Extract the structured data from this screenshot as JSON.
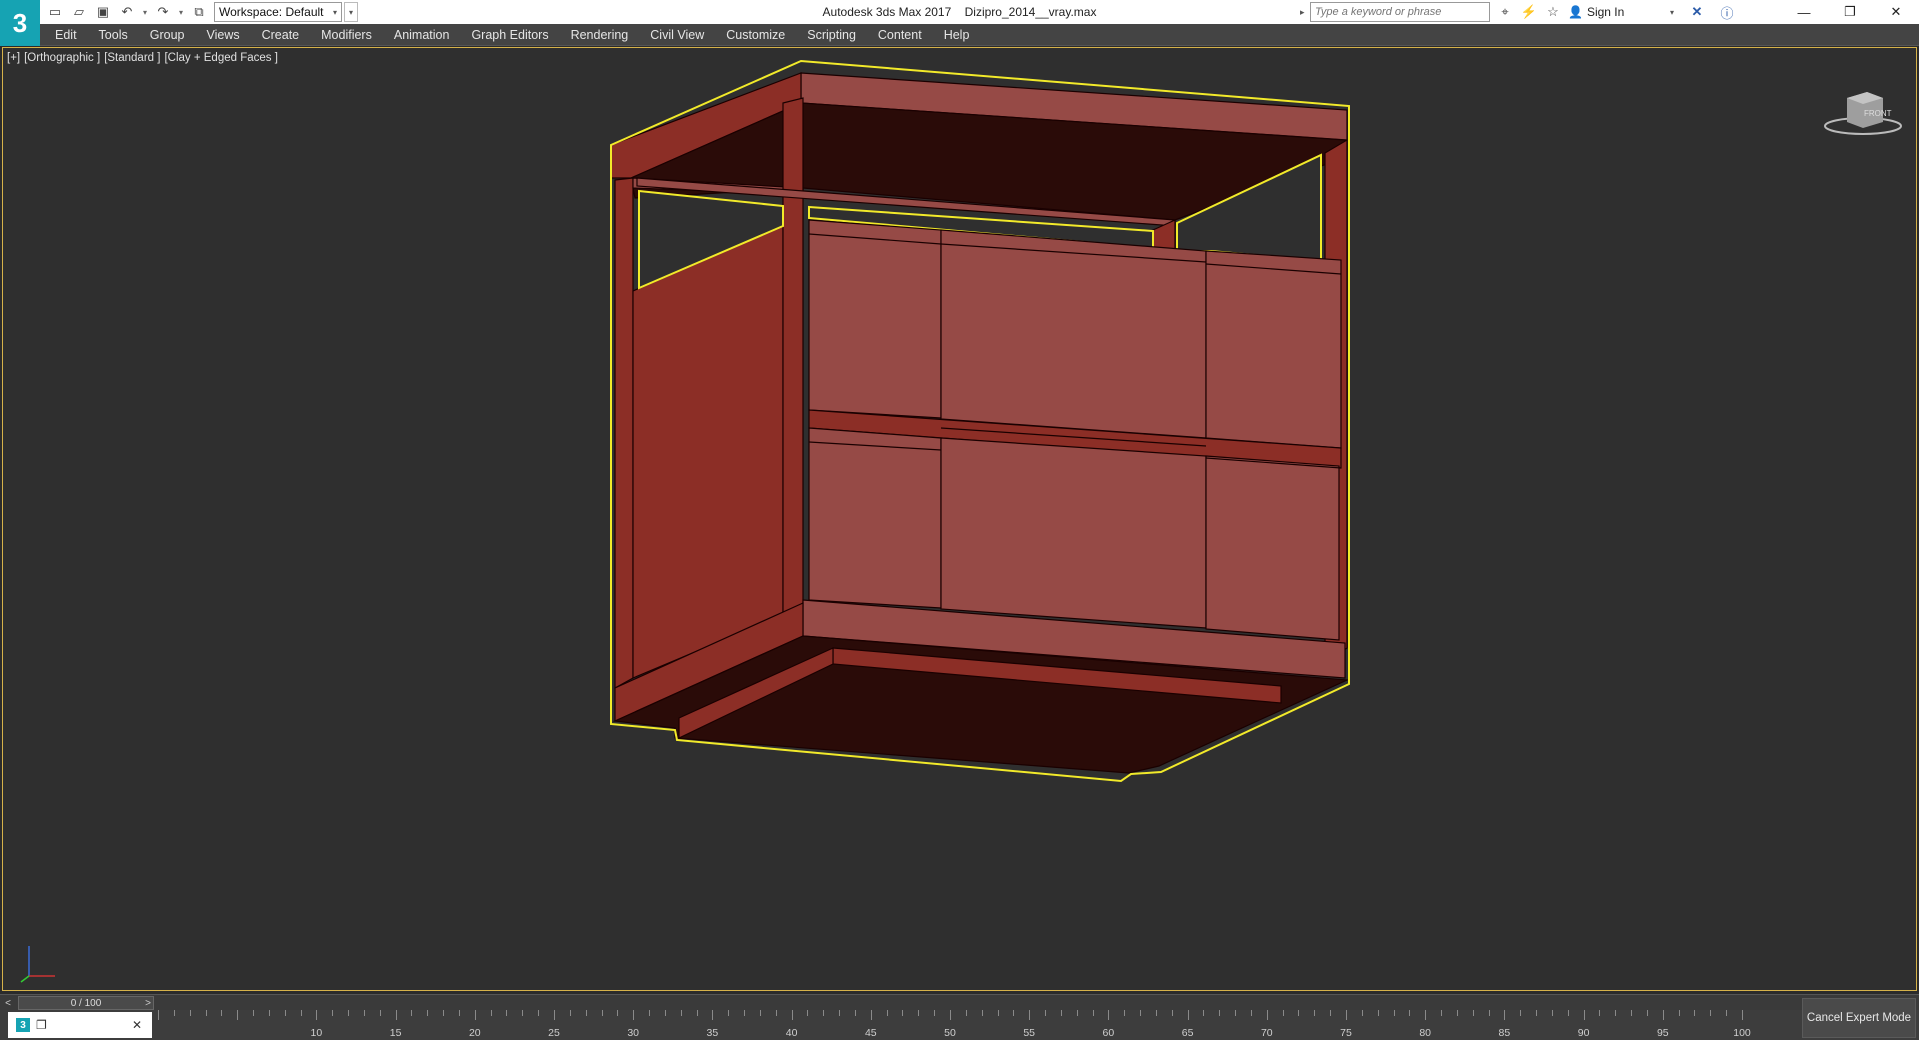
{
  "app": {
    "logo": "3",
    "title": "Autodesk 3ds Max 2017",
    "file_name": "Dizipro_2014__vray.max"
  },
  "quick_access": {
    "icons": [
      "new-file-icon",
      "open-file-icon",
      "save-icon",
      "undo-icon",
      "redo-icon",
      "project-icon"
    ],
    "workspace_label": "Workspace: Default"
  },
  "search": {
    "placeholder": "Type a keyword or phrase"
  },
  "account": {
    "signin_label": "Sign In"
  },
  "menu": {
    "items": [
      "Edit",
      "Tools",
      "Group",
      "Views",
      "Create",
      "Modifiers",
      "Animation",
      "Graph Editors",
      "Rendering",
      "Civil View",
      "Customize",
      "Scripting",
      "Content",
      "Help"
    ]
  },
  "viewport": {
    "label_parts": [
      "[+]",
      "[Orthographic ]",
      "[Standard ]",
      "[Clay + Edged Faces ]"
    ],
    "viewcube_label": "FRONT",
    "colors": {
      "background": "#2f2f2f",
      "model_top": "#964a46",
      "model_side": "#8c2e26",
      "model_dark": "#2a0b08",
      "selection": "#f2ea2a",
      "edges": "#1a0000"
    }
  },
  "time_slider": {
    "frame_display": "0 / 100",
    "prev_label": "<",
    "next_label": ">"
  },
  "trackbar": {
    "tick_labels": [
      "10",
      "15",
      "20",
      "25",
      "30",
      "35",
      "40",
      "45",
      "50",
      "55",
      "60",
      "65",
      "70",
      "75",
      "80",
      "85",
      "90",
      "95",
      "100"
    ]
  },
  "status": {
    "cancel_expert_label": "Cancel Expert Mode"
  }
}
